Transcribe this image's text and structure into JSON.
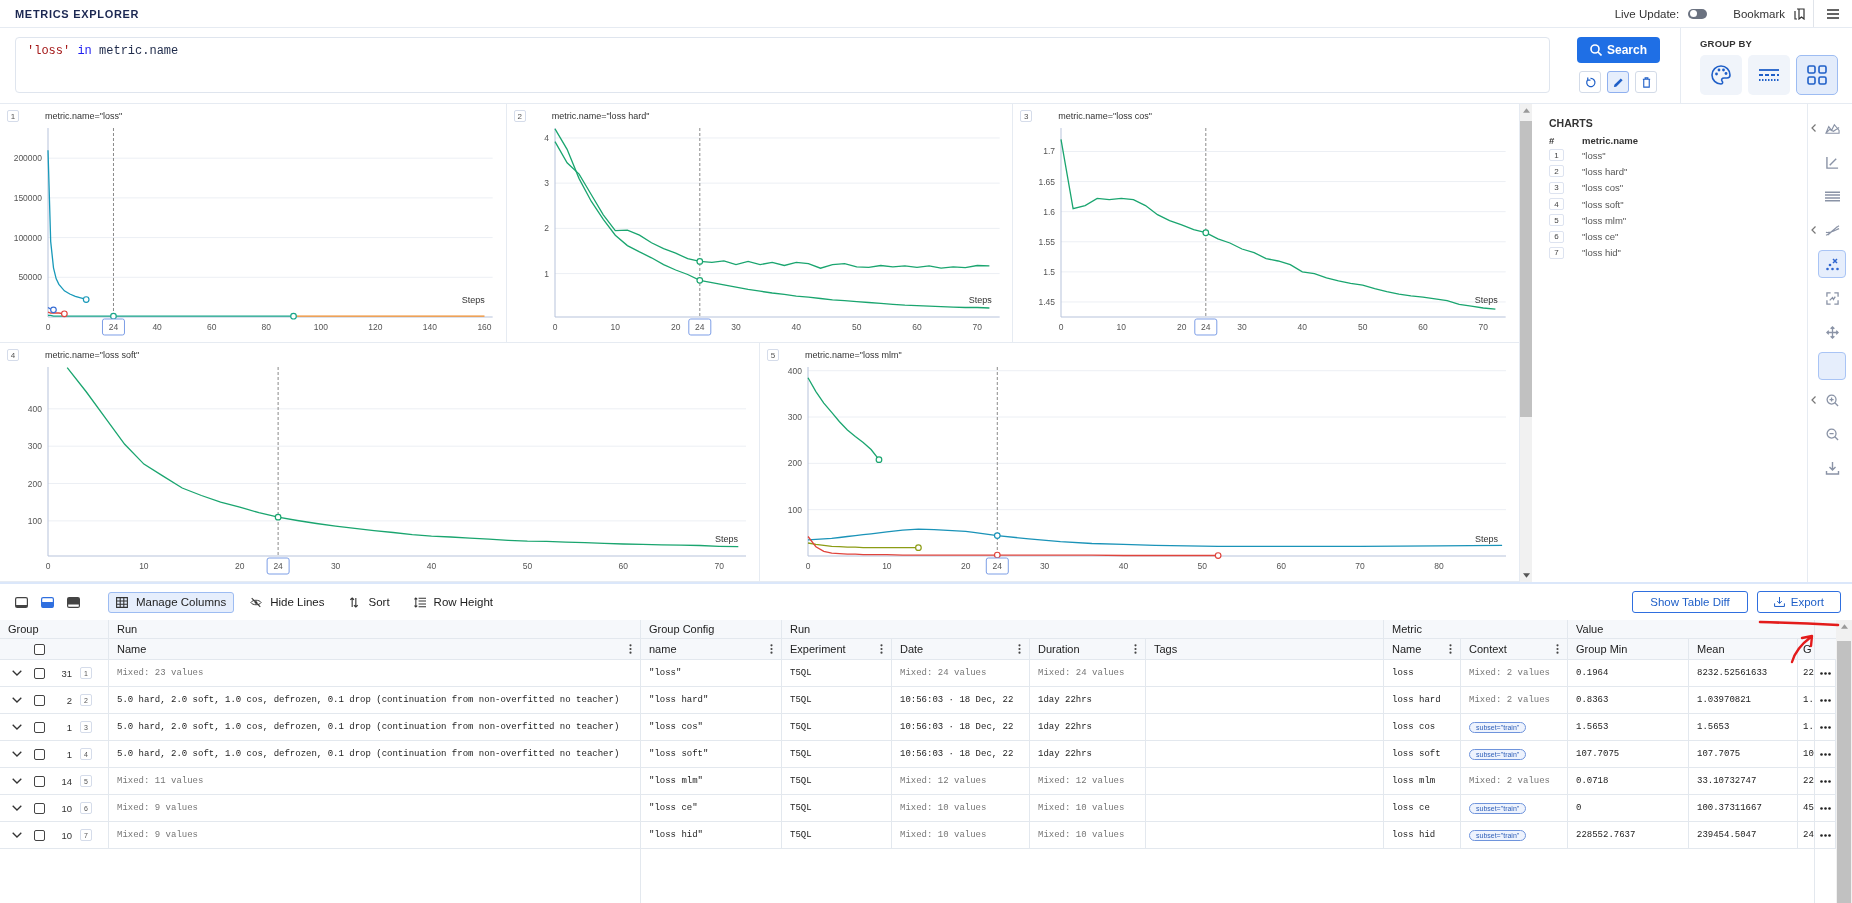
{
  "header": {
    "title": "METRICS EXPLORER",
    "live_update": {
      "label": "Live Update:",
      "on": false
    },
    "bookmark": {
      "label": "Bookmark"
    }
  },
  "search": {
    "query": [
      {
        "text": "'loss'",
        "kind": "string"
      },
      {
        "text": "in",
        "kind": "keyword"
      },
      {
        "text": "metric.name",
        "kind": "name"
      }
    ],
    "button": "Search",
    "actions": [
      {
        "kind": "reset",
        "selected": false
      },
      {
        "kind": "edit",
        "selected": true
      },
      {
        "kind": "delete",
        "selected": false
      }
    ]
  },
  "group_by": {
    "title": "GROUP BY",
    "options": [
      {
        "kind": "color",
        "selected": false
      },
      {
        "kind": "stroke",
        "selected": false
      },
      {
        "kind": "chart",
        "selected": true
      }
    ]
  },
  "charts": [
    {
      "index": "1",
      "chart_data": {
        "type": "line",
        "title": "metric.name=\"loss\"",
        "xlabel": "Steps",
        "x": [
          0,
          1,
          2,
          3,
          4,
          6,
          8,
          10,
          12,
          14,
          16,
          20,
          24,
          30,
          40,
          60,
          80,
          90,
          100,
          120,
          140,
          160
        ],
        "series": [
          {
            "color": "#17a589",
            "values": [
              2000,
              2000,
              1000,
              1000,
              1000,
              1000,
              1000,
              1000,
              1000,
              1000,
              1000,
              1000,
              1000,
              1000,
              1000,
              1000,
              1000,
              1000,
              null,
              null,
              null,
              null
            ]
          },
          {
            "color": "#f08c2a",
            "values": [
              null,
              null,
              null,
              null,
              null,
              null,
              null,
              null,
              null,
              null,
              null,
              null,
              null,
              null,
              null,
              null,
              null,
              1000,
              1000,
              1000,
              1000,
              1000
            ]
          },
          {
            "color": "#1899b9",
            "values": [
              210000,
              95000,
              62000,
              48000,
              41000,
              33000,
              29000,
              26000,
              24000,
              22000,
              null,
              null,
              null,
              null,
              null,
              null,
              null,
              null,
              null,
              null,
              null,
              null
            ]
          },
          {
            "color": "#3b6fd4",
            "values": [
              12000,
              10000,
              9000,
              null,
              null,
              null,
              null,
              null,
              null,
              null,
              null,
              null,
              null,
              null,
              null,
              null,
              null,
              null,
              null,
              null,
              null,
              null
            ]
          },
          {
            "color": "#e0443c",
            "values": [
              6000,
              5000,
              5000,
              5000,
              5000,
              4000,
              null,
              null,
              null,
              null,
              null,
              null,
              null,
              null,
              null,
              null,
              null,
              null,
              null,
              null,
              null,
              null
            ]
          }
        ],
        "xlim": [
          0,
          163
        ],
        "ylim": [
          0,
          238000
        ],
        "xticks": [
          0,
          40,
          60,
          80,
          100,
          120,
          140,
          160
        ],
        "yticks": [
          50000,
          100000,
          150000,
          200000
        ],
        "grid": true,
        "ref_lines": [
          {
            "axis": "x",
            "value": 24,
            "label": "24"
          }
        ]
      }
    },
    {
      "index": "2",
      "chart_data": {
        "type": "line",
        "title": "metric.name=\"loss hard\"",
        "xlabel": "Steps",
        "x": [
          0,
          2,
          4,
          6,
          8,
          10,
          12,
          14,
          16,
          18,
          20,
          22,
          24,
          26,
          28,
          30,
          32,
          34,
          36,
          38,
          40,
          42,
          44,
          46,
          48,
          50,
          52,
          54,
          56,
          58,
          60,
          62,
          64,
          66,
          68,
          70,
          72
        ],
        "series": [
          {
            "color": "#1aa56f",
            "values": [
              3.92,
              3.45,
              3.2,
              2.75,
              2.3,
              1.95,
              1.96,
              1.85,
              1.68,
              1.55,
              1.45,
              1.33,
              1.27,
              1.25,
              1.28,
              1.2,
              1.27,
              1.2,
              1.25,
              1.18,
              1.25,
              1.22,
              1.12,
              1.2,
              1.22,
              1.15,
              1.14,
              1.18,
              1.15,
              1.17,
              1.14,
              1.17,
              1.12,
              1.15,
              1.13,
              1.18,
              1.17
            ]
          },
          {
            "color": "#1aa56f",
            "values": [
              4.2,
              3.75,
              3.1,
              2.6,
              2.2,
              1.85,
              1.62,
              1.48,
              1.35,
              1.2,
              1.08,
              0.98,
              0.85,
              0.8,
              0.75,
              0.7,
              0.65,
              0.61,
              0.57,
              0.54,
              0.5,
              0.48,
              0.45,
              0.42,
              0.4,
              0.38,
              0.36,
              0.34,
              0.32,
              0.3,
              0.29,
              0.28,
              0.27,
              0.26,
              0.25,
              0.25,
              0.24
            ]
          }
        ],
        "xlim": [
          0,
          73.7
        ],
        "ylim": [
          0.04,
          4.22
        ],
        "xticks": [
          0,
          10,
          20,
          30,
          40,
          50,
          60,
          70
        ],
        "yticks": [
          1,
          2,
          3,
          4
        ],
        "grid": true,
        "ref_lines": [
          {
            "axis": "x",
            "value": 24,
            "label": "24"
          }
        ]
      }
    },
    {
      "index": "3",
      "chart_data": {
        "type": "line",
        "title": "metric.name=\"loss cos\"",
        "xlabel": "Steps",
        "x": [
          0,
          2,
          4,
          6,
          8,
          10,
          12,
          14,
          16,
          18,
          20,
          22,
          24,
          26,
          28,
          30,
          32,
          34,
          36,
          38,
          40,
          42,
          44,
          46,
          48,
          50,
          52,
          54,
          56,
          58,
          60,
          62,
          64,
          66,
          68,
          70,
          72
        ],
        "series": [
          {
            "color": "#1aa56f",
            "values": [
              1.72,
              1.605,
              1.61,
              1.622,
              1.62,
              1.622,
              1.62,
              1.61,
              1.595,
              1.585,
              1.578,
              1.57,
              1.565,
              1.555,
              1.548,
              1.538,
              1.532,
              1.522,
              1.518,
              1.512,
              1.5,
              1.497,
              1.49,
              1.485,
              1.481,
              1.478,
              1.472,
              1.467,
              1.463,
              1.46,
              1.458,
              1.455,
              1.452,
              1.446,
              1.443,
              1.44,
              1.438
            ]
          }
        ],
        "xlim": [
          0,
          73.7
        ],
        "ylim": [
          1.425,
          1.739
        ],
        "xticks": [
          0,
          10,
          20,
          30,
          40,
          50,
          60,
          70
        ],
        "yticks": [
          1.45,
          1.5,
          1.55,
          1.6,
          1.65,
          1.7
        ],
        "grid": true,
        "ref_lines": [
          {
            "axis": "x",
            "value": 24,
            "label": "24"
          }
        ]
      }
    },
    {
      "index": "4",
      "chart_data": {
        "type": "line",
        "title": "metric.name=\"loss soft\"",
        "xlabel": "Steps",
        "x": [
          2,
          4,
          6,
          8,
          10,
          12,
          14,
          16,
          18,
          20,
          22,
          24,
          26,
          28,
          30,
          32,
          34,
          36,
          38,
          40,
          42,
          44,
          46,
          48,
          50,
          52,
          54,
          56,
          58,
          60,
          62,
          64,
          66,
          68,
          70,
          72
        ],
        "series": [
          {
            "color": "#1aa56f",
            "values": [
              510,
              445,
              375,
              305,
              252,
              220,
              188,
              168,
              150,
              137,
              122,
              110,
              101,
              93,
              86,
              80,
              74,
              69,
              63,
              59,
              57,
              54,
              51,
              48,
              46,
              45,
              43,
              42,
              40,
              38,
              37,
              36,
              35,
              34,
              32,
              31
            ]
          }
        ],
        "xlim": [
          0,
          72.8
        ],
        "ylim": [
          6,
          512
        ],
        "xticks": [
          0,
          10,
          20,
          30,
          40,
          50,
          60,
          70
        ],
        "yticks": [
          100,
          200,
          300,
          400
        ],
        "grid": true,
        "ref_lines": [
          {
            "axis": "x",
            "value": 24,
            "label": "24"
          }
        ]
      }
    },
    {
      "index": "5",
      "chart_data": {
        "type": "line",
        "title": "metric.name=\"loss mlm\"",
        "xlabel": "Steps",
        "x": [
          0,
          1,
          2,
          3,
          4,
          5,
          6,
          7,
          8,
          9,
          10,
          12,
          14,
          16,
          20,
          21,
          24,
          28,
          32,
          36,
          40,
          44,
          48,
          52,
          60,
          70,
          80,
          88
        ],
        "series": [
          {
            "color": "#1aa56f",
            "values": [
              385,
              355,
              330,
              310,
              290,
              272,
              258,
              245,
              230,
              208,
              null,
              null,
              null,
              null,
              null,
              null,
              null,
              null,
              null,
              null,
              null,
              null,
              null,
              null,
              null,
              null,
              null,
              null
            ]
          },
          {
            "color": "#1a93b8",
            "values": [
              35,
              36,
              37,
              38,
              40,
              42,
              44,
              46,
              48,
              50,
              52,
              56,
              58,
              57,
              53,
              51,
              44,
              37,
              31,
              27,
              25,
              23,
              22,
              21,
              21,
              21,
              22,
              23
            ]
          },
          {
            "color": "#8c9c15",
            "values": [
              28,
              25,
              23,
              21,
              20,
              19,
              19,
              18,
              18,
              18,
              18,
              18,
              18,
              null,
              null,
              null,
              null,
              null,
              null,
              null,
              null,
              null,
              null,
              null,
              null,
              null,
              null,
              null
            ]
          },
          {
            "color": "#e0443c",
            "values": [
              42,
              20,
              10,
              6,
              5,
              4,
              4,
              3,
              3,
              3,
              3,
              2,
              2,
              2,
              2,
              2,
              2,
              2,
              2,
              2,
              1,
              1,
              1,
              1,
              null,
              null,
              null,
              null
            ]
          }
        ],
        "xlim": [
          0,
          88.5
        ],
        "ylim": [
          0,
          408
        ],
        "xticks": [
          0,
          10,
          20,
          30,
          40,
          50,
          60,
          70,
          80
        ],
        "yticks": [
          100,
          200,
          300,
          400
        ],
        "grid": true,
        "ref_lines": [
          {
            "axis": "x",
            "value": 24,
            "label": "24"
          }
        ]
      }
    }
  ],
  "charts_panel": {
    "title": "CHARTS",
    "columns": [
      "#",
      "metric.name"
    ],
    "rows": [
      {
        "index": "1",
        "name": "\"loss\""
      },
      {
        "index": "2",
        "name": "\"loss hard\""
      },
      {
        "index": "3",
        "name": "\"loss cos\""
      },
      {
        "index": "4",
        "name": "\"loss soft\""
      },
      {
        "index": "5",
        "name": "\"loss mlm\""
      },
      {
        "index": "6",
        "name": "\"loss ce\""
      },
      {
        "index": "7",
        "name": "\"loss hid\""
      }
    ]
  },
  "chart_toolbar": [
    {
      "kind": "area",
      "submenu": true,
      "selected": false
    },
    {
      "kind": "axes",
      "submenu": false,
      "selected": false
    },
    {
      "kind": "lines",
      "submenu": false,
      "selected": false
    },
    {
      "kind": "curves",
      "submenu": true,
      "selected": false
    },
    {
      "kind": "scatter",
      "submenu": false,
      "selected": true
    },
    {
      "kind": "frame",
      "submenu": false,
      "selected": false
    },
    {
      "kind": "move",
      "submenu": false,
      "selected": false
    },
    {
      "kind": "blank",
      "submenu": false,
      "selected": true
    },
    {
      "kind": "zoom-in",
      "submenu": true,
      "selected": false
    },
    {
      "kind": "zoom-out",
      "submenu": false,
      "selected": false
    },
    {
      "kind": "download",
      "submenu": false,
      "selected": false
    }
  ],
  "table_toolbar": {
    "views": [
      {
        "kind": "hidden",
        "selected": false
      },
      {
        "kind": "half",
        "selected": true
      },
      {
        "kind": "full",
        "selected": false
      }
    ],
    "tools": [
      {
        "kind": "columns",
        "label": "Manage Columns",
        "active": true
      },
      {
        "kind": "hide",
        "label": "Hide Lines",
        "active": false
      },
      {
        "kind": "sort",
        "label": "Sort",
        "active": false
      },
      {
        "kind": "height",
        "label": "Row Height",
        "active": false
      }
    ],
    "buttons": [
      {
        "kind": "diff",
        "label": "Show Table Diff"
      },
      {
        "kind": "export",
        "label": "Export"
      }
    ]
  },
  "table": {
    "column_groups": [
      {
        "label": "Group",
        "columns": [
          {
            "kind": "select",
            "checked": false
          }
        ]
      },
      {
        "label": "Run",
        "columns": [
          {
            "kind": "text",
            "label": "Name",
            "menu": true
          }
        ]
      },
      {
        "label": "Group Config",
        "columns": [
          {
            "kind": "text",
            "label": "name",
            "menu": true
          }
        ]
      },
      {
        "label": "Run",
        "columns": [
          {
            "kind": "text",
            "label": "Experiment",
            "menu": true
          },
          {
            "kind": "text",
            "label": "Date",
            "menu": true
          },
          {
            "kind": "text",
            "label": "Duration",
            "menu": true
          },
          {
            "kind": "text",
            "label": "Tags",
            "menu": false
          }
        ]
      },
      {
        "label": "Metric",
        "columns": [
          {
            "kind": "text",
            "label": "Name",
            "menu": true
          },
          {
            "kind": "text",
            "label": "Context",
            "menu": true
          }
        ]
      },
      {
        "label": "Value",
        "columns": [
          {
            "kind": "text",
            "label": "Group Min",
            "menu": false
          },
          {
            "kind": "text",
            "label": "Mean",
            "menu": false
          },
          {
            "kind": "text",
            "label": "G",
            "menu": false
          }
        ]
      }
    ],
    "rows": [
      {
        "count": "31",
        "index": "1",
        "expanded": false,
        "checked": false,
        "run_name": {
          "text": "Mixed: 23 values",
          "kind": "mixed"
        },
        "group_name": "\"loss\"",
        "experiment": "T5QL",
        "date": {
          "text": "Mixed: 24 values",
          "kind": "mixed"
        },
        "duration": {
          "text": "Mixed: 24 values",
          "kind": "mixed"
        },
        "metric_name": "loss",
        "context": {
          "text": "Mixed: 2 values",
          "kind": "mixed"
        },
        "group_min": "0.1964",
        "mean": "8232.52561633",
        "column_12": "22"
      },
      {
        "count": "2",
        "index": "2",
        "expanded": false,
        "checked": false,
        "run_name": {
          "text": "5.0 hard, 2.0 soft, 1.0 cos, defrozen, 0.1 drop (continuation from non-overfitted no teacher)",
          "kind": "value"
        },
        "group_name": "\"loss hard\"",
        "experiment": "T5QL",
        "date": {
          "text": "10:56:03 · 18 Dec, 22",
          "kind": "value"
        },
        "duration": {
          "text": "1day 22hrs",
          "kind": "value"
        },
        "metric_name": "loss hard",
        "context": {
          "text": "Mixed: 2 values",
          "kind": "mixed"
        },
        "group_min": "0.8363",
        "mean": "1.03970821",
        "column_12": "1."
      },
      {
        "count": "1",
        "index": "3",
        "expanded": false,
        "checked": false,
        "run_name": {
          "text": "5.0 hard, 2.0 soft, 1.0 cos, defrozen, 0.1 drop (continuation from non-overfitted no teacher)",
          "kind": "value"
        },
        "group_name": "\"loss cos\"",
        "experiment": "T5QL",
        "date": {
          "text": "10:56:03 · 18 Dec, 22",
          "kind": "value"
        },
        "duration": {
          "text": "1day 22hrs",
          "kind": "value"
        },
        "metric_name": "loss cos",
        "context": {
          "text": "subset=\"train\"",
          "kind": "tag"
        },
        "group_min": "1.5653",
        "mean": "1.5653",
        "column_12": "1."
      },
      {
        "count": "1",
        "index": "4",
        "expanded": false,
        "checked": false,
        "run_name": {
          "text": "5.0 hard, 2.0 soft, 1.0 cos, defrozen, 0.1 drop (continuation from non-overfitted no teacher)",
          "kind": "value"
        },
        "group_name": "\"loss soft\"",
        "experiment": "T5QL",
        "date": {
          "text": "10:56:03 · 18 Dec, 22",
          "kind": "value"
        },
        "duration": {
          "text": "1day 22hrs",
          "kind": "value"
        },
        "metric_name": "loss soft",
        "context": {
          "text": "subset=\"train\"",
          "kind": "tag"
        },
        "group_min": "107.7075",
        "mean": "107.7075",
        "column_12": "10"
      },
      {
        "count": "14",
        "index": "5",
        "expanded": false,
        "checked": false,
        "run_name": {
          "text": "Mixed: 11 values",
          "kind": "mixed"
        },
        "group_name": "\"loss mlm\"",
        "experiment": "T5QL",
        "date": {
          "text": "Mixed: 12 values",
          "kind": "mixed"
        },
        "duration": {
          "text": "Mixed: 12 values",
          "kind": "mixed"
        },
        "metric_name": "loss mlm",
        "context": {
          "text": "Mixed: 2 values",
          "kind": "mixed"
        },
        "group_min": "0.0718",
        "mean": "33.10732747",
        "column_12": "22"
      },
      {
        "count": "10",
        "index": "6",
        "expanded": false,
        "checked": false,
        "run_name": {
          "text": "Mixed: 9 values",
          "kind": "mixed"
        },
        "group_name": "\"loss ce\"",
        "experiment": "T5QL",
        "date": {
          "text": "Mixed: 10 values",
          "kind": "mixed"
        },
        "duration": {
          "text": "Mixed: 10 values",
          "kind": "mixed"
        },
        "metric_name": "loss ce",
        "context": {
          "text": "subset=\"train\"",
          "kind": "tag"
        },
        "group_min": "0",
        "mean": "100.37311667",
        "column_12": "45"
      },
      {
        "count": "10",
        "index": "7",
        "expanded": false,
        "checked": false,
        "run_name": {
          "text": "Mixed: 9 values",
          "kind": "mixed"
        },
        "group_name": "\"loss hid\"",
        "experiment": "T5QL",
        "date": {
          "text": "Mixed: 10 values",
          "kind": "mixed"
        },
        "duration": {
          "text": "Mixed: 10 values",
          "kind": "mixed"
        },
        "metric_name": "loss hid",
        "context": {
          "text": "subset=\"train\"",
          "kind": "tag"
        },
        "group_min": "228552.7637",
        "mean": "239454.5047",
        "column_12": "24"
      }
    ]
  },
  "markup": {
    "underline": true,
    "arrow": true
  }
}
